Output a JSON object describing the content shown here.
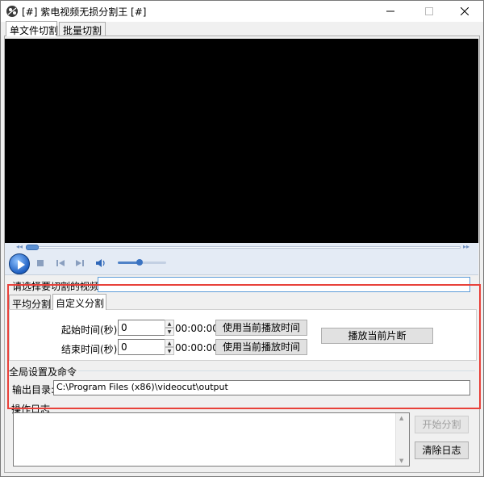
{
  "window": {
    "title": "[#] 紫电视频无损分割王 [#]",
    "icon": "app-logo-icon",
    "buttons": [
      "minimize-icon",
      "maximize-icon",
      "close-icon"
    ]
  },
  "main_tabs": [
    {
      "label": "单文件切割",
      "active": true
    },
    {
      "label": "批量切割",
      "active": false
    }
  ],
  "player": {
    "controls": [
      "play-icon",
      "stop-icon",
      "previous-icon",
      "next-icon",
      "volume-icon"
    ],
    "volume_level": 0.45,
    "seek_position": 0.0
  },
  "select_video": {
    "label": "请选择要切割的视频:",
    "value": ""
  },
  "split_tabs": [
    {
      "label": "平均分割",
      "active": false
    },
    {
      "label": "自定义分割",
      "active": true
    }
  ],
  "custom_split": {
    "start_label": "起始时间(秒):",
    "start_value": "0",
    "start_time_display": "00:00:00",
    "end_label": "结束时间(秒):",
    "end_value": "0",
    "end_time_display": "00:00:00",
    "use_current_button": "使用当前播放时间",
    "play_segment_button": "播放当前片断"
  },
  "global": {
    "group_label": "全局设置及命令",
    "output_label": "输出目录:",
    "output_value": "C:\\Program Files (x86)\\videocut\\output"
  },
  "log": {
    "group_label": "操作日志",
    "content": ""
  },
  "actions": {
    "start_button": "开始分割",
    "clear_button": "清除日志"
  },
  "colors": {
    "highlight": "#e8413a",
    "video_bg": "#000000",
    "player_bar": "#e4ebf5"
  }
}
